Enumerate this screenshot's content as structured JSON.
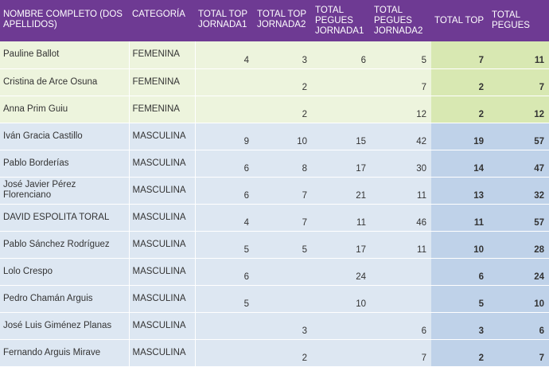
{
  "table": {
    "headers": [
      "NOMBRE COMPLETO (DOS APELLIDOS)",
      "CATEGORÍA",
      "TOTAL TOP JORNADA1",
      "TOTAL TOP JORNADA2",
      "TOTAL PEGUES JORNADA1",
      "TOTAL PEGUES JORNADA2",
      "TOTAL TOP",
      "TOTAL PEGUES"
    ],
    "rows": [
      [
        "Pauline Ballot",
        "FEMENINA",
        "4",
        "3",
        "6",
        "5",
        "7",
        "11"
      ],
      [
        "Cristina de Arce Osuna",
        "FEMENINA",
        "",
        "2",
        "",
        "7",
        "2",
        "7"
      ],
      [
        "Anna Prim Guiu",
        "FEMENINA",
        "",
        "2",
        "",
        "12",
        "2",
        "12"
      ],
      [
        "Iván Gracia Castillo",
        "MASCULINA",
        "9",
        "10",
        "15",
        "42",
        "19",
        "57"
      ],
      [
        "Pablo Borderías",
        "MASCULINA",
        "6",
        "8",
        "17",
        "30",
        "14",
        "47"
      ],
      [
        "José Javier Pérez Florenciano",
        "MASCULINA",
        "6",
        "7",
        "21",
        "11",
        "13",
        "32"
      ],
      [
        "DAVID ESPOLITA TORAL",
        "MASCULINA",
        "4",
        "7",
        "11",
        "46",
        "11",
        "57"
      ],
      [
        "Pablo Sánchez Rodríguez",
        "MASCULINA",
        "5",
        "5",
        "17",
        "11",
        "10",
        "28"
      ],
      [
        "Lolo Crespo",
        "MASCULINA",
        "6",
        "",
        "24",
        "",
        "6",
        "24"
      ],
      [
        "Pedro Chamán Arguis",
        "MASCULINA",
        "5",
        "",
        "10",
        "",
        "5",
        "10"
      ],
      [
        "José Luis Giménez Planas",
        "MASCULINA",
        "",
        "3",
        "",
        "6",
        "3",
        "6"
      ],
      [
        "Fernando Arguis Mirave",
        "MASCULINA",
        "",
        "2",
        "",
        "7",
        "2",
        "7"
      ]
    ]
  },
  "colors": {
    "header_bg": "#6e3a93",
    "femenina_bg": "#edf4dd",
    "femenina_total_bg": "#d8e8b2",
    "masculina_bg": "#dde7f2",
    "masculina_total_bg": "#bfd2e9"
  }
}
